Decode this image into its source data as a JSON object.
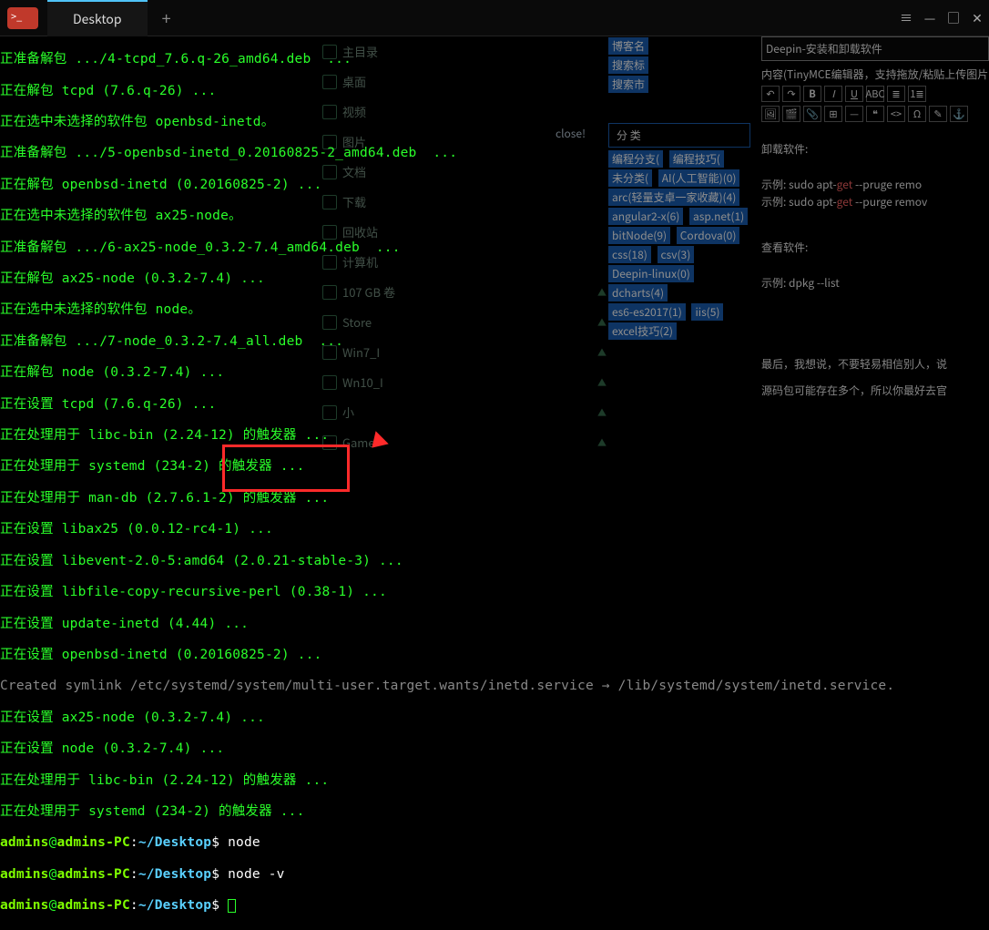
{
  "titlebar": {
    "tab_label": "Desktop",
    "new_tab": "+",
    "menu": "≡",
    "min": "—",
    "max": "□",
    "close": "✕"
  },
  "terminal_lines": [
    "正准备解包 .../4-tcpd_7.6.q-26_amd64.deb  ...",
    "正在解包 tcpd (7.6.q-26) ...",
    "正在选中未选择的软件包 openbsd-inetd。",
    "正准备解包 .../5-openbsd-inetd_0.20160825-2_amd64.deb  ...",
    "正在解包 openbsd-inetd (0.20160825-2) ...",
    "正在选中未选择的软件包 ax25-node。",
    "正准备解包 .../6-ax25-node_0.3.2-7.4_amd64.deb  ...",
    "正在解包 ax25-node (0.3.2-7.4) ...",
    "正在选中未选择的软件包 node。",
    "正准备解包 .../7-node_0.3.2-7.4_all.deb  ...",
    "正在解包 node (0.3.2-7.4) ...",
    "正在设置 tcpd (7.6.q-26) ...",
    "正在处理用于 libc-bin (2.24-12) 的触发器 ...",
    "正在处理用于 systemd (234-2) 的触发器 ...",
    "正在处理用于 man-db (2.7.6.1-2) 的触发器 ...",
    "正在设置 libax25 (0.0.12-rc4-1) ...",
    "正在设置 libevent-2.0-5:amd64 (2.0.21-stable-3) ...",
    "正在设置 libfile-copy-recursive-perl (0.38-1) ...",
    "正在设置 update-inetd (4.44) ...",
    "正在设置 openbsd-inetd (0.20160825-2) ..."
  ],
  "symlink_line": "Created symlink /etc/systemd/system/multi-user.target.wants/inetd.service → /lib/systemd/system/inetd.service.",
  "post_lines": [
    "正在设置 ax25-node (0.3.2-7.4) ...",
    "正在设置 node (0.3.2-7.4) ...",
    "正在处理用于 libc-bin (2.24-12) 的触发器 ...",
    "正在处理用于 systemd (234-2) 的触发器 ..."
  ],
  "prompt": {
    "user": "admins",
    "host": "admins-PC",
    "path": "~/Desktop",
    "dollar": "$"
  },
  "commands": [
    "node",
    "node -v"
  ],
  "fm_items": [
    "主目录",
    "桌面",
    "视频",
    "图片",
    "文档",
    "下载",
    "回收站",
    "计算机",
    "107 GB 卷",
    "Store",
    "Win7_I",
    "Wn10_I",
    "小",
    "Game"
  ],
  "fm_close": "close!",
  "right": {
    "title": "Deepin-安装和卸载软件",
    "content_label": "内容(TinyMCE编辑器，支持拖放/粘贴上传图片",
    "section1": "卸载软件:",
    "code1a_pre": "示例: sudo apt-",
    "code1a_kw": "get",
    "code1a_post": "  --pruge remo",
    "code1b_pre": "示例: sudo apt-",
    "code1b_kw": "get",
    "code1b_post": " --purge remov",
    "section2": "查看软件:",
    "code2": "示例: dpkg --list",
    "para1": "最后，我想说，不要轻易相信别人，说",
    "para2": "源码包可能存在多个，所以你最好去官"
  },
  "right_tags_top": [
    "博客名",
    "搜索标",
    "搜索市"
  ],
  "right_cat_header": "分    类",
  "right_tags": [
    "编程分支(",
    "编程技巧(",
    "未分类(",
    "AI(人工智能)(0)",
    "arc(轻量支卓一家收藏)(4)",
    "angular2-x(6)",
    "asp.net(1)",
    "bitNode(9)",
    "Cordova(0)",
    "css(18)",
    "csv(3)",
    "Deepin-linux(0)",
    "dcharts(4)",
    "es6-es2017(1)",
    "iis(5)",
    "excel技巧(2)"
  ]
}
